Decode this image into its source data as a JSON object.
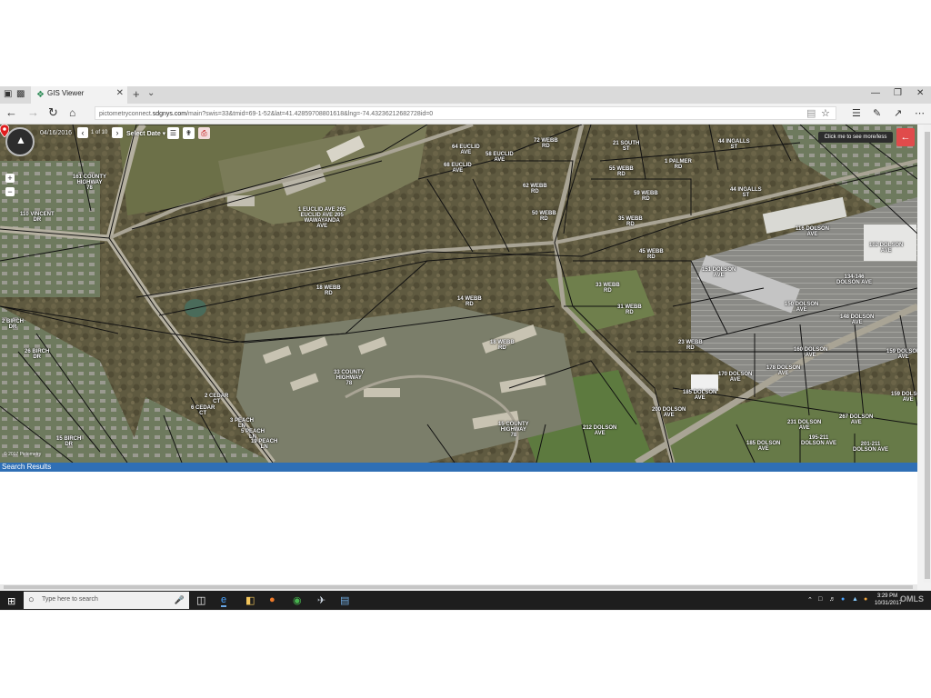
{
  "browser": {
    "tab_title": "GIS Viewer",
    "url_prefix": "pictometryconnect.",
    "url_domain": "sdgnys.com",
    "url_rest": "/main?swis=33&tmid=69-1-52&lat=41.42859708801618&lng=-74.43236212682728id=0"
  },
  "map_toolbar": {
    "date": "04/16/2016",
    "page_count": "1 of 10",
    "select_date": "Select Date ▾",
    "tooltip": "Click me to see more/less",
    "copyright": "© 2017 Pictometry"
  },
  "parcels": [
    {
      "id": "p1",
      "label": "161 COUNTY\nHIGHWAY\n78"
    },
    {
      "id": "p2",
      "label": "110 VINCENT\nDR"
    },
    {
      "id": "p3",
      "label": "64 EUCLID\nAVE"
    },
    {
      "id": "p4",
      "label": "58 EUCLID\nAVE"
    },
    {
      "id": "p5",
      "label": "68 EUCLID\nAVE"
    },
    {
      "id": "p6",
      "label": "72 WEBB\nRD"
    },
    {
      "id": "p7",
      "label": "21 SOUTH\nST"
    },
    {
      "id": "p8",
      "label": "44 INGALLS\nST"
    },
    {
      "id": "p9",
      "label": "1 PALMER\nRD"
    },
    {
      "id": "p10",
      "label": "55 WEBB\nRD"
    },
    {
      "id": "p11",
      "label": "62 WEBB\nRD"
    },
    {
      "id": "p12",
      "label": "59 WEBB\nRD"
    },
    {
      "id": "p13",
      "label": "44 INGALLS\nST"
    },
    {
      "id": "p14",
      "label": "1 EUCLID AVE 205\nEUCLID AVE 205\nWAWAYANDA\nAVE"
    },
    {
      "id": "p15",
      "label": "50 WEBB\nRD"
    },
    {
      "id": "p16",
      "label": "35 WEBB\nRD"
    },
    {
      "id": "p17",
      "label": "116 DOLSON\nAVE"
    },
    {
      "id": "p18",
      "label": "45 WEBB\nRD"
    },
    {
      "id": "p19",
      "label": "102 DOLSON\nAVE"
    },
    {
      "id": "p20",
      "label": "151 DOLSON\nAVE"
    },
    {
      "id": "p21",
      "label": "18 WEBB\nRD"
    },
    {
      "id": "p22",
      "label": "14 WEBB\nRD"
    },
    {
      "id": "p23",
      "label": "33 WEBB\nRD"
    },
    {
      "id": "p24",
      "label": "134-146\nDOLSON AVE"
    },
    {
      "id": "p25",
      "label": "31 WEBB\nRD"
    },
    {
      "id": "p26",
      "label": "150 DOLSON\nAVE"
    },
    {
      "id": "p27",
      "label": "2 BIRCH\nDR"
    },
    {
      "id": "p28",
      "label": "148 DOLSON\nAVE"
    },
    {
      "id": "p29",
      "label": "18 WEBB\nRD"
    },
    {
      "id": "p30",
      "label": "23 WEBB\nRD"
    },
    {
      "id": "p31",
      "label": "26 BIRCH\nDR"
    },
    {
      "id": "p32",
      "label": "160 DOLSON\nAVE"
    },
    {
      "id": "p33",
      "label": "159 DOLSON\nAVE"
    },
    {
      "id": "p34",
      "label": "33 COUNTY\nHIGHWAY\n78"
    },
    {
      "id": "p35",
      "label": "170 DOLSON\nAVE"
    },
    {
      "id": "p36",
      "label": "178 DOLSON\nAVE"
    },
    {
      "id": "p37",
      "label": "2 CEDAR\nCT"
    },
    {
      "id": "p38",
      "label": "185 DOLSON\nAVE"
    },
    {
      "id": "p39",
      "label": "159 DOLSON\nAVE"
    },
    {
      "id": "p40",
      "label": "6 CEDAR\nCT"
    },
    {
      "id": "p41",
      "label": "200 DOLSON\nAVE"
    },
    {
      "id": "p42",
      "label": "3 PEACH\nLN"
    },
    {
      "id": "p43",
      "label": "267 DOLSON\nAVE"
    },
    {
      "id": "p44",
      "label": "5 PEACH\nLN"
    },
    {
      "id": "p45",
      "label": "15 COUNTY\nHIGHWAY\n78"
    },
    {
      "id": "p46",
      "label": "231 DOLSON\nAVE"
    },
    {
      "id": "p47",
      "label": "19 PEACH\nLN"
    },
    {
      "id": "p48",
      "label": "212 DOLSON\nAVE"
    },
    {
      "id": "p49",
      "label": "15 BIRCH\nDR"
    },
    {
      "id": "p50",
      "label": "185 DOLSON\nAVE"
    },
    {
      "id": "p51",
      "label": "201-211\nDOLSON AVE"
    },
    {
      "id": "p52",
      "label": "195-211\nDOLSON AVE"
    }
  ],
  "search_results": {
    "title": "Search Results"
  },
  "taskbar": {
    "search_placeholder": "Type here to search",
    "time": "3:29 PM",
    "date": "10/31/2017",
    "watermark": "OMLS"
  }
}
